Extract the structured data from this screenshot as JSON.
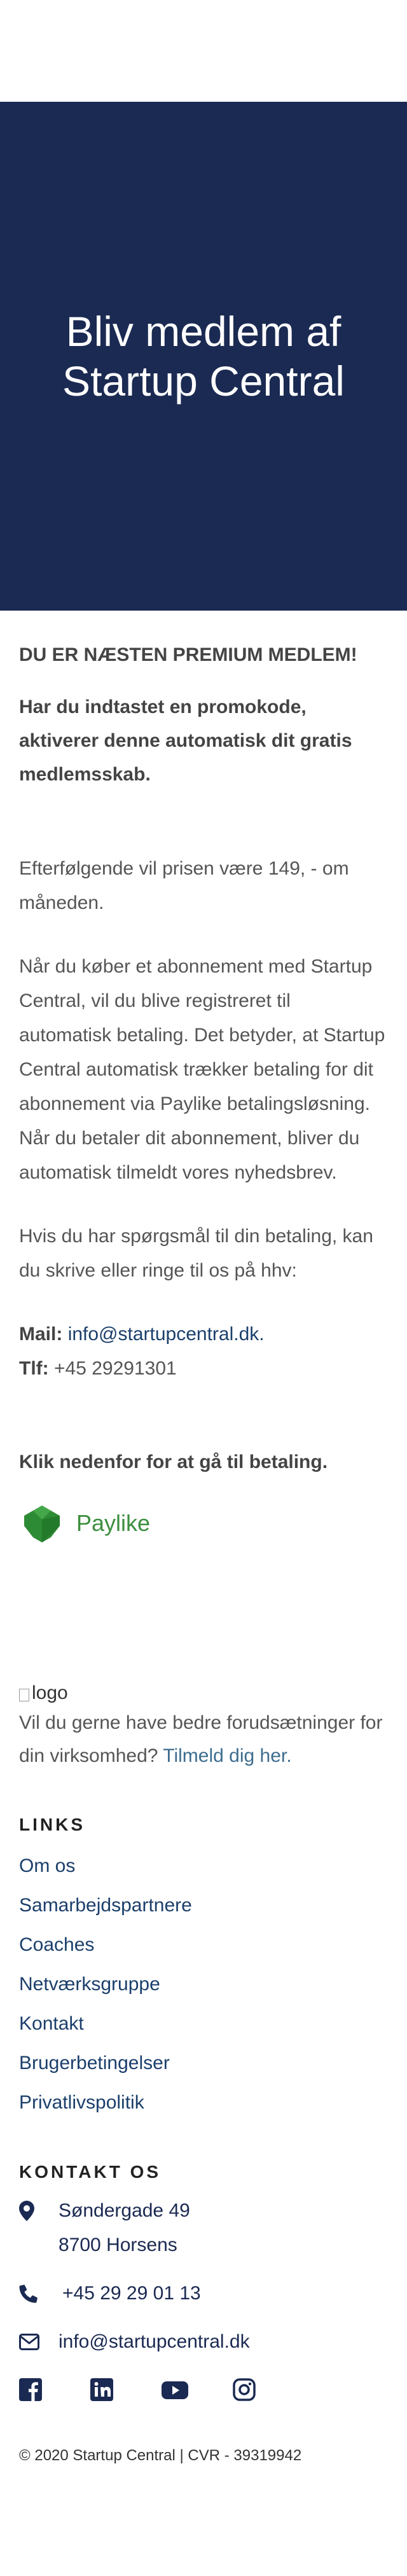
{
  "hero": {
    "title_line1": "Bliv medlem af",
    "title_line2": "Startup Central"
  },
  "membership": {
    "heading": "DU ER NÆSTEN PREMIUM MEDLEM!",
    "promo": "Har du indtastet en promokode, aktiverer denne automatisk dit gratis medlemsskab.",
    "price_text": "Efterfølgende vil prisen være 149, - om måneden.",
    "subscription_text": "Når du køber et abonnement med Startup Central, vil du blive registreret til automatisk betaling. Det betyder, at Startup Central automatisk trækker betaling for dit abonnement via Paylike betalingsløsning. Når du betaler dit abonnement, bliver du automatisk tilmeldt vores nyhedsbrev.",
    "questions_text": "Hvis du har spørgsmål til din betaling, kan du skrive eller ringe til os på hhv:",
    "mail_label": "Mail:",
    "mail_value": "info@startupcentral.dk.",
    "phone_label": "Tlf:",
    "phone_value": "+45 29291301",
    "payment_heading": "Klik nedenfor for at gå til betaling.",
    "paylike_label": "Paylike"
  },
  "footer": {
    "logo_alt": "logo",
    "signup_text": "Vil du gerne have bedre forudsætninger for din virksomhed?",
    "signup_link": "Tilmeld dig her.",
    "links_heading": "LINKS",
    "links": [
      "Om os",
      "Samarbejdspartnere",
      "Coaches",
      "Netværksgruppe",
      "Kontakt",
      "Brugerbetingelser",
      "Privatlivspolitik"
    ],
    "contact_heading": "KONTAKT OS",
    "address_line1": "Søndergade 49",
    "address_line2": "8700 Horsens",
    "phone": "+45 29 29 01 13",
    "email": "info@startupcentral.dk",
    "social": [
      "facebook-icon",
      "linkedin-icon",
      "youtube-icon",
      "instagram-icon"
    ],
    "copyright": "© 2020 Startup Central | CVR - 39319942"
  },
  "colors": {
    "hero_bg": "#1b2a52",
    "link": "#1b3f6b",
    "paylike_green": "#3c8f3f"
  }
}
